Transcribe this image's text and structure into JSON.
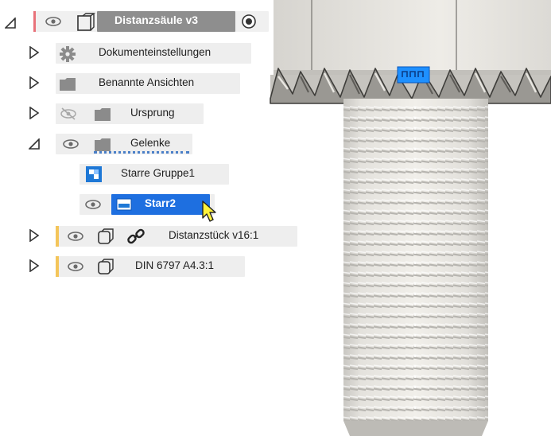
{
  "browser": {
    "root": {
      "label": "Distanzsäule v3",
      "icon": "component-icon"
    },
    "items": [
      {
        "label": "Dokumenteinstellungen",
        "icon": "gear-icon"
      },
      {
        "label": "Benannte Ansichten",
        "icon": "folder-icon"
      },
      {
        "label": "Ursprung",
        "icon": "folder-icon",
        "visibility_icon": "eye-hidden-icon"
      },
      {
        "label": "Gelenke",
        "icon": "folder-icon",
        "visibility_icon": "eye-icon",
        "expanded": true,
        "children": [
          {
            "label": "Starre Gruppe1",
            "icon": "rigid-group-icon"
          },
          {
            "label": "Starr2",
            "icon": "rigid-joint-icon",
            "selected": true
          }
        ]
      },
      {
        "label": "Distanzstück v16:1",
        "icon": "body-icon",
        "link_icon": "link-icon"
      },
      {
        "label": "DIN 6797 A4.3:1",
        "icon": "body-icon"
      }
    ]
  },
  "colors": {
    "selection": "#1e6fe0",
    "component_marker": "#f4c55a",
    "active_marker": "#e8727a",
    "joint_glyph": "#1e90ff"
  }
}
